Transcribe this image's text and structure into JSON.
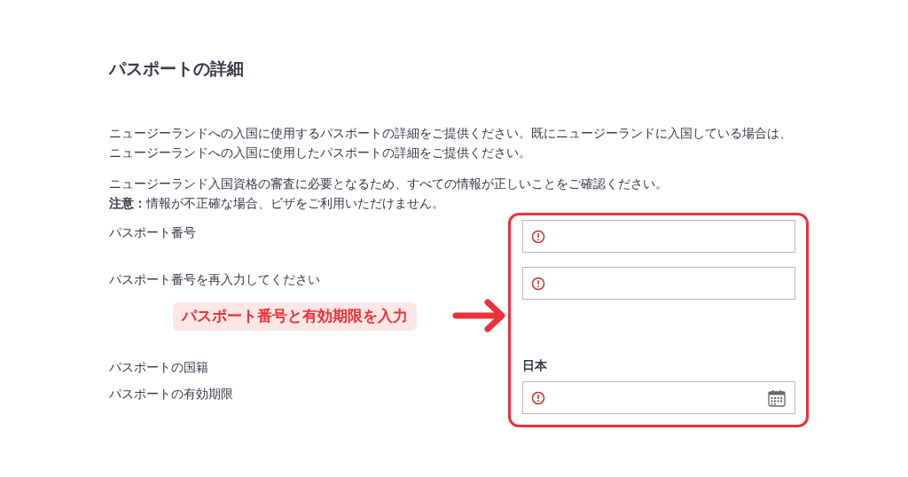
{
  "title": "パスポートの詳細",
  "paragraphs": [
    "ニュージーランドへの入国に使用するパスポートの詳細をご提供ください。既にニュージーランドに入国している場合は、ニュージーランドへの入国に使用したパスポートの詳細をご提供ください。",
    "ニュージーランド入国資格の審査に必要となるため、すべての情報が正しいことをご確認ください。",
    "**注意：**情報が不正確な場合、ビザをご利用いただけません。"
  ],
  "fields": [
    {
      "label": "パスポート番号",
      "kind": "input",
      "error": true
    },
    {
      "label": "パスポート番号を再入力してください",
      "kind": "input",
      "error": true
    },
    {
      "label": "パスポートの国籍",
      "kind": "text",
      "value": "日本"
    },
    {
      "label": "パスポートの有効期限",
      "kind": "date",
      "error": true
    }
  ],
  "annotation": {
    "callout": "パスポート番号と有効期限を入力"
  }
}
